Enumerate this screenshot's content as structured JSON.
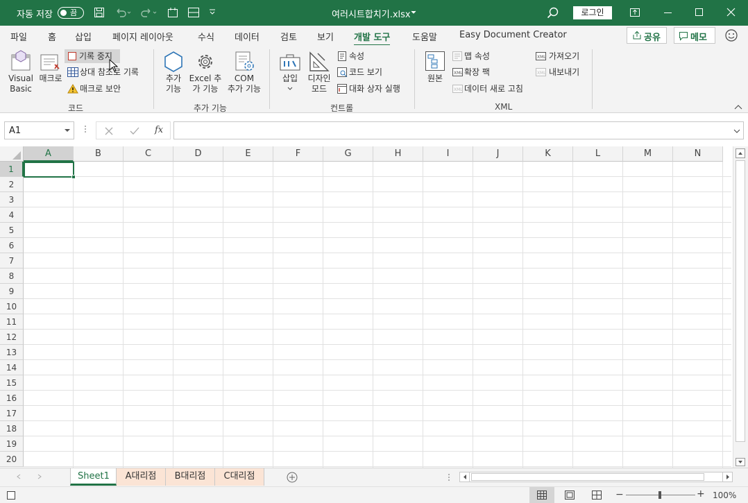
{
  "titlebar": {
    "autosave_label": "자동 저장",
    "autosave_state": "끔",
    "filename": "여러시트합치기.xlsx",
    "login_label": "로그인"
  },
  "tabs": [
    "파일",
    "홈",
    "삽입",
    "페이지 레이아웃",
    "수식",
    "데이터",
    "검토",
    "보기",
    "개발 도구",
    "도움말",
    "Easy Document Creator"
  ],
  "active_tab": "개발 도구",
  "share_label": "공유",
  "memo_label": "메모",
  "ribbon": {
    "code": {
      "group_label": "코드",
      "visual_basic": "Visual\nBasic",
      "macro": "매크로",
      "record_stop": "기록 중지",
      "relative_ref": "상대 참조로 기록",
      "macro_security": "매크로 보안"
    },
    "addins": {
      "group_label": "추가 기능",
      "addin": "추가\n기능",
      "excel_addin": "Excel 추\n가 기능",
      "com_addin": "COM\n추가 기능"
    },
    "controls": {
      "group_label": "컨트롤",
      "insert": "삽입",
      "design_mode": "디자인\n모드",
      "properties": "속성",
      "view_code": "코드 보기",
      "run_dialog": "대화 상자 실행"
    },
    "xml": {
      "group_label": "XML",
      "source": "원본",
      "map_properties": "맵 속성",
      "expansion_packs": "확장 팩",
      "refresh_data": "데이터 새로 고침",
      "import": "가져오기",
      "export": "내보내기"
    }
  },
  "formula_bar": {
    "name_box": "A1",
    "fx": "fx",
    "value": ""
  },
  "columns": [
    "A",
    "B",
    "C",
    "D",
    "E",
    "F",
    "G",
    "H",
    "I",
    "J",
    "K",
    "L",
    "M",
    "N"
  ],
  "rows": [
    "1",
    "2",
    "3",
    "4",
    "5",
    "6",
    "7",
    "8",
    "9",
    "10",
    "11",
    "12",
    "13",
    "14",
    "15",
    "16",
    "17",
    "18",
    "19",
    "20"
  ],
  "sheets": [
    "Sheet1",
    "A대리점",
    "B대리점",
    "C대리점"
  ],
  "active_sheet": "Sheet1",
  "status": {
    "zoom": "100%"
  },
  "colors": {
    "brand": "#217346",
    "sheet_tab_peach": "#fbe4d5"
  }
}
